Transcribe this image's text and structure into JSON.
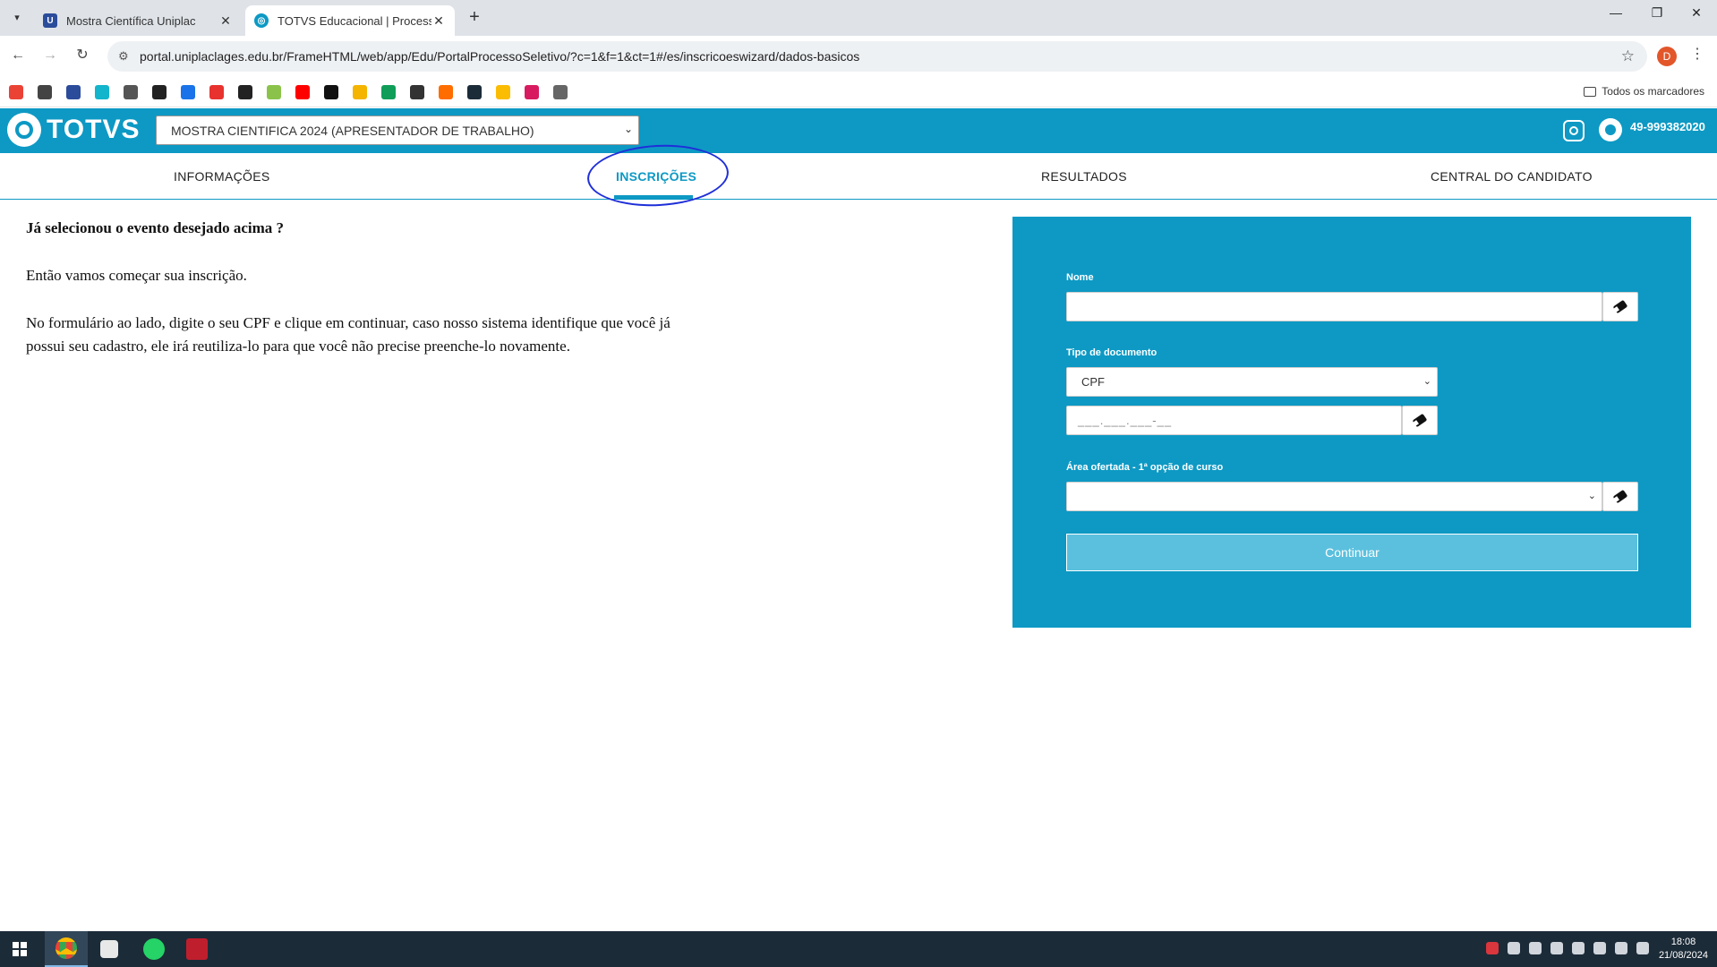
{
  "browser": {
    "tabs": [
      {
        "title": "Mostra Científica Uniplac",
        "active": false,
        "favicon_color": "#2b4c9b",
        "favicon": "uniplac-icon"
      },
      {
        "title": "TOTVS Educacional | Processo S",
        "active": true,
        "favicon_color": "#0d99c4",
        "favicon": "totvs-icon"
      }
    ],
    "url": "portal.uniplaclages.edu.br/FrameHTML/web/app/Edu/PortalProcessoSeletivo/?c=1&f=1&ct=1#/es/inscricoeswizard/dados-basicos",
    "profile_initial": "D",
    "bookmarks_all_label": "Todos os marcadores",
    "bookmark_colors": [
      "#ea4335",
      "#444444",
      "#2b4c9b",
      "#12b5cb",
      "#555555",
      "#222222",
      "#1a73e8",
      "#e8322e",
      "#222222",
      "#8bc34a",
      "#ff0000",
      "#111111",
      "#f4b400",
      "#0f9d58",
      "#333333",
      "#ff6d00",
      "#1c2b38",
      "#fbbc04",
      "#d81b60",
      "#666666"
    ]
  },
  "header": {
    "logo_text": "TOTVS",
    "event_selected": "MOSTRA CIENTIFICA 2024 (APRESENTADOR DE TRABALHO)",
    "phone": "49-999382020",
    "accent_color": "#0d99c4"
  },
  "menu": {
    "items": [
      "INFORMAÇÕES",
      "INSCRIÇÕES",
      "RESULTADOS",
      "CENTRAL DO CANDIDATO"
    ],
    "active": "INSCRIÇÕES"
  },
  "intro": {
    "question": "Já selecionou o evento desejado acima ?",
    "start": "Então vamos começar sua inscrição.",
    "instructions": "No formulário ao lado, digite o seu CPF e clique em continuar, caso nosso sistema identifique que você já possui seu cadastro, ele irá reutiliza-lo para que você não precise preenche-lo novamente."
  },
  "form": {
    "name_label": "Nome",
    "name_value": "",
    "doc_type_label": "Tipo de documento",
    "doc_type_value": "CPF",
    "cpf_placeholder": "___.___.___-__",
    "area_label": "Área ofertada - 1ª opção de curso",
    "area_value": "",
    "continue_label": "Continuar"
  },
  "taskbar": {
    "time": "18:08",
    "date": "21/08/2024",
    "apps": [
      "chrome-icon",
      "window-app-icon",
      "whatsapp-icon",
      "filezilla-icon"
    ]
  }
}
